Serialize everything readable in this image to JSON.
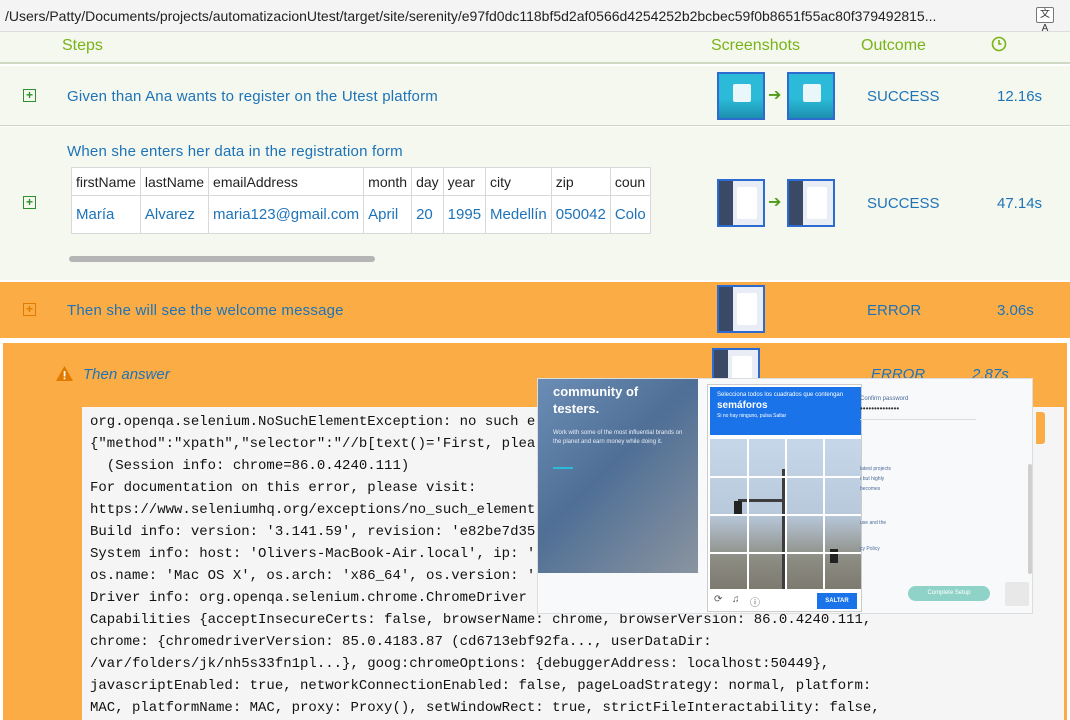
{
  "urlbar": {
    "path": "/Users/Patty/Documents/projects/automatizacionUtest/target/site/serenity/e97fd0dc118bf5d2af0566d4254252b2bcbec59f0b8651f55ac80f379492815...",
    "translate_icon": "translate-icon"
  },
  "header": {
    "steps": "Steps",
    "screenshots": "Screenshots",
    "outcome": "Outcome",
    "duration_icon": "clock-icon"
  },
  "rows": [
    {
      "step": "Given than Ana wants to register on the Utest platform",
      "outcome": "SUCCESS",
      "duration": "12.16s"
    },
    {
      "step": "When she enters her data in the registration form",
      "outcome": "SUCCESS",
      "duration": "47.14s",
      "table": {
        "headers": [
          "firstName",
          "lastName",
          "emailAddress",
          "month",
          "day",
          "year",
          "city",
          "zip",
          "coun"
        ],
        "values": [
          "María",
          "Alvarez",
          "maria123@gmail.com",
          "April",
          "20",
          "1995",
          "Medellín",
          "050042",
          "Colo"
        ]
      }
    },
    {
      "step": "Then she will see the welcome message",
      "outcome": "ERROR",
      "duration": "3.06s"
    },
    {
      "step": "Then answer",
      "outcome": "ERROR",
      "duration": "2.87s"
    }
  ],
  "colors": {
    "accent_green": "#7ab317",
    "link_blue": "#1e73b8",
    "error_orange": "#fbac44",
    "row_bg": "#f4f8ee"
  },
  "console_lines": [
    "org.openqa.selenium.NoSuchElementException: no such e",
    "{\"method\":\"xpath\",\"selector\":\"//b[text()='First, plea",
    "  (Session info: chrome=86.0.4240.111)",
    "For documentation on this error, please visit:",
    "https://www.seleniumhq.org/exceptions/no_such_element",
    "Build info: version: '3.141.59', revision: 'e82be7d35",
    "System info: host: 'Olivers-MacBook-Air.local', ip: '",
    "os.name: 'Mac OS X', os.arch: 'x86_64', os.version: '",
    "Driver info: org.openqa.selenium.chrome.ChromeDriver",
    "Capabilities {acceptInsecureCerts: false, browserName: chrome, browserVersion: 86.0.4240.111,",
    "chrome: {chromedriverVersion: 85.0.4183.87 (cd6713ebf92fa..., userDataDir:",
    "/var/folders/jk/nh5s33fn1pl...}, goog:chromeOptions: {debuggerAddress: localhost:50449},",
    "javascriptEnabled: true, networkConnectionEnabled: false, pageLoadStrategy: normal, platform:",
    "MAC, platformName: MAC, proxy: Proxy(), setWindowRect: true, strictFileInteractability: false,"
  ],
  "overlay": {
    "hero_title_1": "community of",
    "hero_title_2": "testers.",
    "hero_text": "Work with some of the most influential brands on the planet and earn money while doing it.",
    "captcha_instruction": "Selecciona todos los cuadrados que contengan",
    "captcha_target": "semáforos",
    "captcha_hint": "Si no hay ninguno, pulsa Saltar",
    "captcha_skip": "SALTAR",
    "confirm_password_label": "Confirm password",
    "password_mask": "••••••••••••••",
    "side_text_1": "latest projects",
    "side_text_2": "t but highly",
    "side_text_3": "becomes",
    "side_text_4": "use and the",
    "side_text_5": "cy Policy",
    "complete_button": "Complete Setup"
  }
}
